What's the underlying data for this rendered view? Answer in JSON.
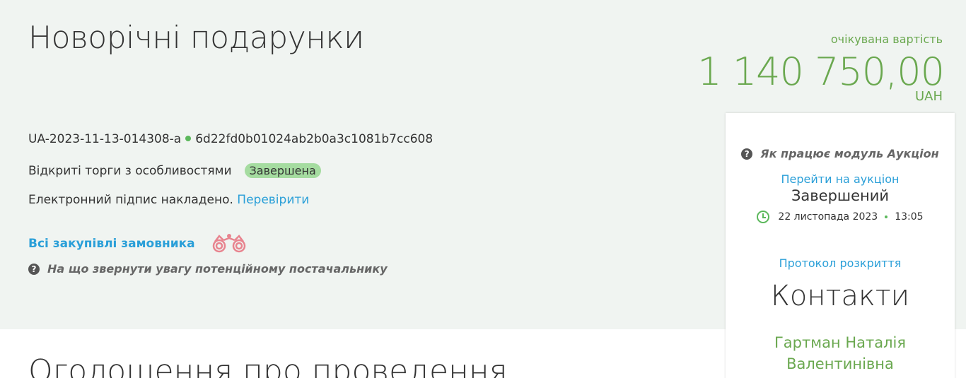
{
  "header": {
    "title": "Новорічні подарунки"
  },
  "value": {
    "label": "очікувана вартість",
    "amount": "1 140 750,00",
    "currency": "UAH"
  },
  "tender": {
    "id": "UA-2023-11-13-014308-a",
    "hash": "6d22fd0b01024ab2b0a3c1081b7cc608",
    "procedure": "Відкриті торги з особливостями",
    "status": "Завершена",
    "signature_text": "Електронний підпис накладено.",
    "signature_link": "Перевірити",
    "buyer_link": "Всі закупівлі замовника",
    "hint": "На що звернути увагу потенційному постачальнику"
  },
  "auction": {
    "hint": "Як працює модуль Аукціон",
    "link": "Перейти на аукціон",
    "status": "Завершений",
    "date": "22 листопада 2023",
    "time": "13:05",
    "protocol_link": "Протокол розкриття"
  },
  "contacts": {
    "title": "Контакти",
    "name": "Гартман Наталія Валентинівна"
  },
  "section": {
    "title": "Оголошення про проведення"
  },
  "colors": {
    "accent_green": "#6aa84f",
    "link_blue": "#2a9fd8",
    "badge_green": "#a5dca0",
    "hero_bg": "#f0f4f1"
  },
  "icons": {
    "question": "question-circle-icon",
    "binoculars": "binoculars-icon",
    "clock": "clock-icon"
  }
}
